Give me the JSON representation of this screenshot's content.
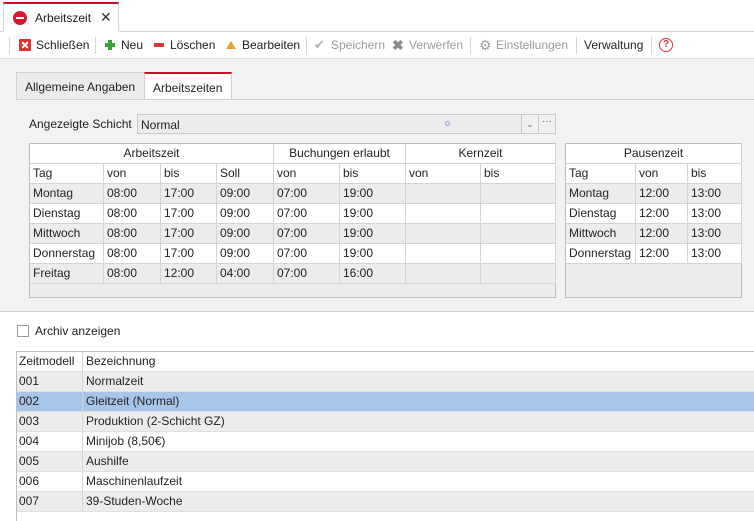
{
  "window": {
    "tab_title": "Arbeitszeit",
    "close_glyph": "✕"
  },
  "toolbar": {
    "close_label": "Schließen",
    "new_label": "Neu",
    "delete_label": "Löschen",
    "edit_label": "Bearbeiten",
    "save_label": "Speichern",
    "discard_label": "Verwerfen",
    "settings_label": "Einstellungen",
    "admin_label": "Verwaltung",
    "help_glyph": "?"
  },
  "form": {
    "tabs": [
      "Allgemeine Angaben",
      "Arbeitszeiten"
    ],
    "active_tab": "Arbeitszeiten",
    "schicht_label": "Angezeigte Schicht",
    "schicht_value": "Normal",
    "dropdown_glyph": "⌄",
    "more_glyph": "···"
  },
  "work_grid": {
    "bands": [
      "Arbeitszeit",
      "Buchungen erlaubt",
      "Kernzeit"
    ],
    "columns": [
      "Tag",
      "von",
      "bis",
      "Soll",
      "von",
      "bis",
      "von",
      "bis"
    ],
    "rows": [
      [
        "Montag",
        "08:00",
        "17:00",
        "09:00",
        "07:00",
        "19:00",
        "",
        ""
      ],
      [
        "Dienstag",
        "08:00",
        "17:00",
        "09:00",
        "07:00",
        "19:00",
        "",
        ""
      ],
      [
        "Mittwoch",
        "08:00",
        "17:00",
        "09:00",
        "07:00",
        "19:00",
        "",
        ""
      ],
      [
        "Donnerstag",
        "08:00",
        "17:00",
        "09:00",
        "07:00",
        "19:00",
        "",
        ""
      ],
      [
        "Freitag",
        "08:00",
        "12:00",
        "04:00",
        "07:00",
        "16:00",
        "",
        ""
      ]
    ]
  },
  "break_grid": {
    "band": "Pausenzeit",
    "columns": [
      "Tag",
      "von",
      "bis"
    ],
    "rows": [
      [
        "Montag",
        "12:00",
        "13:00"
      ],
      [
        "Dienstag",
        "12:00",
        "13:00"
      ],
      [
        "Mittwoch",
        "12:00",
        "13:00"
      ],
      [
        "Donnerstag",
        "12:00",
        "13:00"
      ]
    ]
  },
  "archive": {
    "label": "Archiv anzeigen",
    "checked": false
  },
  "model_list": {
    "columns": [
      "Zeitmodell",
      "Bezeichnung"
    ],
    "selected_index": 1,
    "rows": [
      [
        "001",
        "Normalzeit"
      ],
      [
        "002",
        "Gleitzeit (Normal)"
      ],
      [
        "003",
        "Produktion (2-Schicht GZ)"
      ],
      [
        "004",
        "Minijob (8,50€)"
      ],
      [
        "005",
        "Aushilfe"
      ],
      [
        "006",
        "Maschinenlaufzeit"
      ],
      [
        "007",
        "39-Studen-Woche"
      ]
    ]
  },
  "colors": {
    "accent": "#c8102e",
    "selection": "#a8c4e8"
  }
}
